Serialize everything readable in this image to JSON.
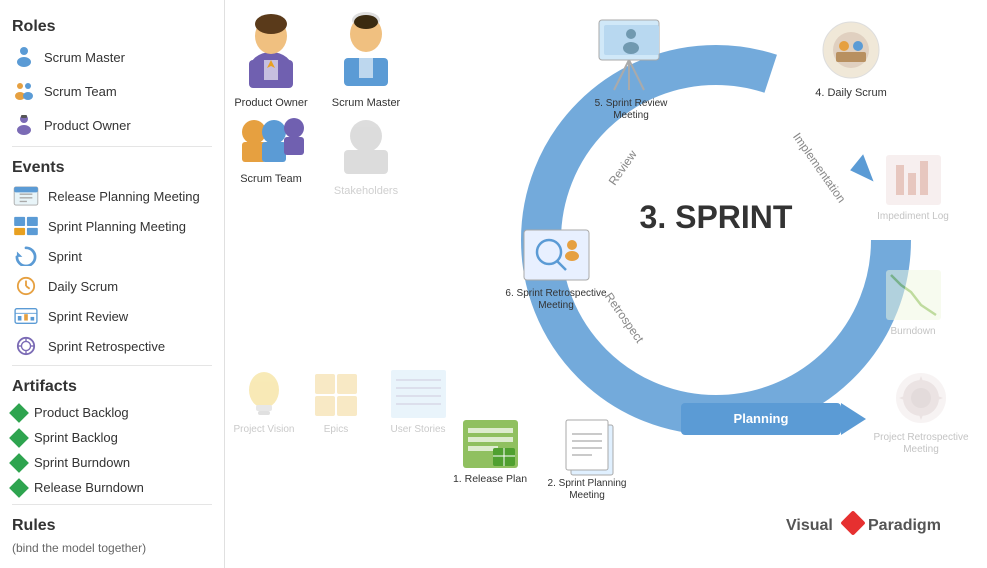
{
  "sidebar": {
    "roles_title": "Roles",
    "roles": [
      {
        "label": "Scrum Master",
        "icon": "scrum-master"
      },
      {
        "label": "Scrum Team",
        "icon": "scrum-team"
      },
      {
        "label": "Product Owner",
        "icon": "product-owner"
      }
    ],
    "events_title": "Events",
    "events": [
      {
        "label": "Release Planning Meeting",
        "icon": "calendar"
      },
      {
        "label": "Sprint Planning  Meeting",
        "icon": "grid"
      },
      {
        "label": "Sprint",
        "icon": "refresh"
      },
      {
        "label": "Daily Scrum",
        "icon": "clock"
      },
      {
        "label": "Sprint Review",
        "icon": "chart"
      },
      {
        "label": "Sprint Retrospective",
        "icon": "settings"
      }
    ],
    "artifacts_title": "Artifacts",
    "artifacts": [
      {
        "label": "Product Backlog",
        "color": "#2ea44f"
      },
      {
        "label": "Sprint Backlog",
        "color": "#2ea44f"
      },
      {
        "label": "Sprint Burndown",
        "color": "#2ea44f"
      },
      {
        "label": "Release Burndown",
        "color": "#2ea44f"
      }
    ],
    "rules_title": "Rules",
    "rules_sub": "(bind the model together)"
  },
  "figures": [
    {
      "label": "Product Owner",
      "col": 1,
      "row": 1
    },
    {
      "label": "Scrum Master",
      "col": 2,
      "row": 1
    },
    {
      "label": "Scrum Team",
      "col": 1,
      "row": 2
    },
    {
      "label": "Stakeholders",
      "col": 2,
      "row": 2
    }
  ],
  "artifacts_bottom": [
    {
      "label": "Project Vision"
    },
    {
      "label": "Epics"
    },
    {
      "label": "User Stories"
    }
  ],
  "diagram": {
    "sprint_label": "3. SPRINT",
    "nodes": [
      {
        "id": "release-plan",
        "label": "1. Release Plan"
      },
      {
        "id": "sprint-planning",
        "label": "2. Sprint Planning\nMeeting"
      },
      {
        "id": "sprint-review",
        "label": "5. Sprint Review\nMeeting"
      },
      {
        "id": "sprint-retro",
        "label": "6. Sprint Retrospective\nMeeting"
      },
      {
        "id": "daily-scrum",
        "label": "4. Daily Scrum"
      },
      {
        "id": "impediment-log",
        "label": "Impediment Log"
      },
      {
        "id": "burndown",
        "label": "Burndown"
      },
      {
        "id": "retro-meeting",
        "label": "Project Retrospective\nMeeting"
      }
    ],
    "arrows": [
      "Planning",
      "Review",
      "Retrospect",
      "Implementation"
    ]
  },
  "branding": {
    "text1": "Visual",
    "text2": "Paradigm"
  }
}
